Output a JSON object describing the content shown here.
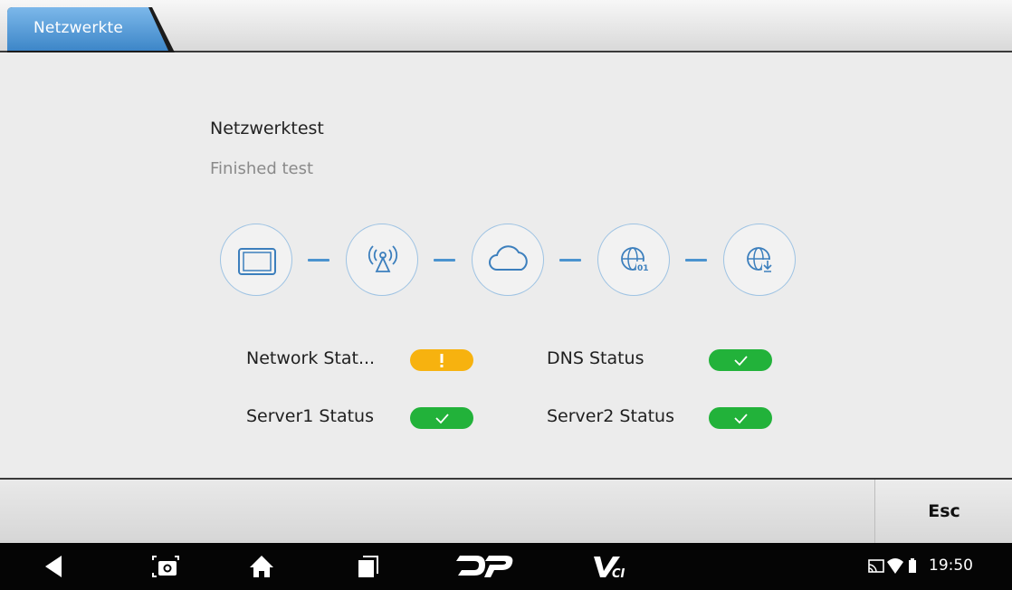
{
  "tab": {
    "label": "Netzwerkte"
  },
  "main": {
    "title": "Netzwerktest",
    "subtitle": "Finished test",
    "steps": [
      {
        "icon": "tablet-icon"
      },
      {
        "icon": "antenna-icon"
      },
      {
        "icon": "cloud-icon"
      },
      {
        "icon": "globe-data-icon"
      },
      {
        "icon": "globe-download-icon"
      }
    ],
    "statuses": [
      {
        "label": "Network Stat...",
        "state": "warning",
        "symbol": "!"
      },
      {
        "label": "DNS Status",
        "state": "ok",
        "symbol": "check"
      },
      {
        "label": "Server1 Status",
        "state": "ok",
        "symbol": "check"
      },
      {
        "label": "Server2 Status",
        "state": "ok",
        "symbol": "check"
      }
    ]
  },
  "actions": {
    "esc_label": "Esc"
  },
  "navbar": {
    "icons": [
      "back-icon",
      "screenshot-icon",
      "home-icon",
      "recents-icon",
      "dp-logo-icon",
      "vci-logo-icon"
    ],
    "clock": "19:50",
    "tray_icons": [
      "cast-icon",
      "wifi-icon",
      "battery-icon"
    ]
  },
  "colors": {
    "accent_blue": "#4b93cf",
    "warning": "#f7b20f",
    "ok": "#22b23a"
  }
}
